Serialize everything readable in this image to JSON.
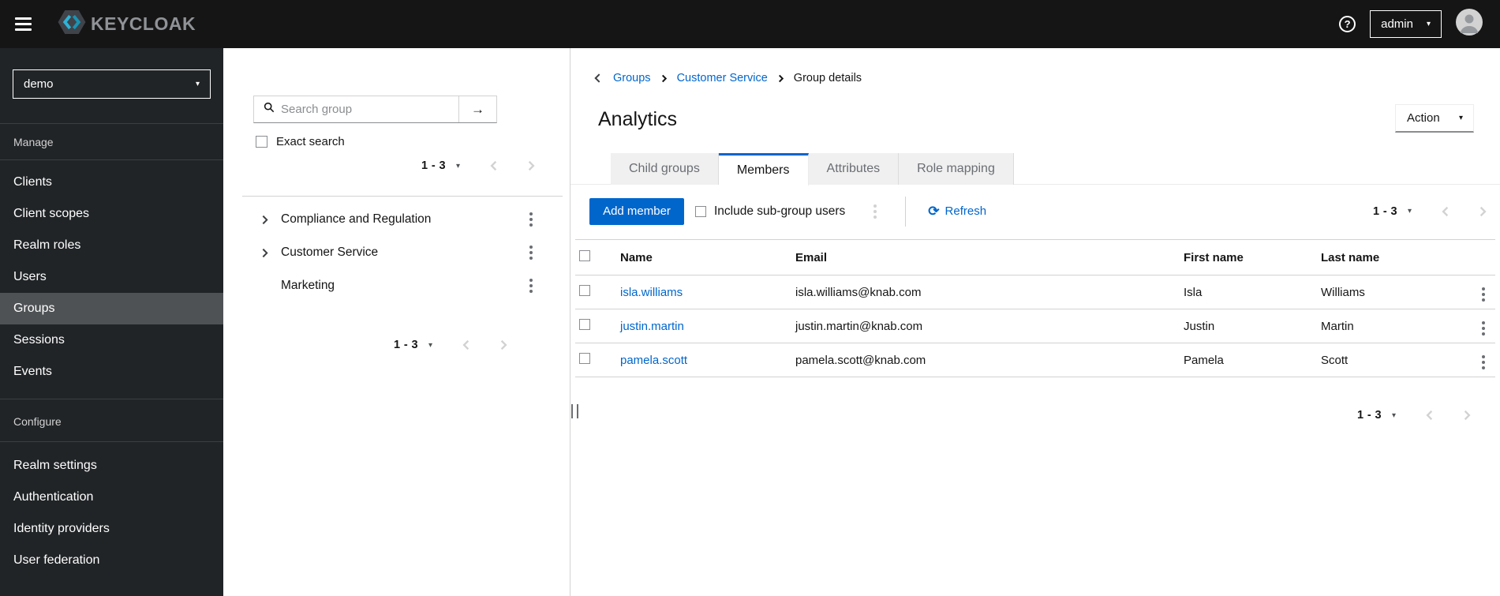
{
  "icons": {
    "caret_down": "▾",
    "arrow_right": "→",
    "refresh": "⟳",
    "help": "?"
  },
  "header": {
    "brand": "KEYCLOAK",
    "user": "admin"
  },
  "sidebar": {
    "realm": "demo",
    "selected_item": "Groups",
    "groups": [
      {
        "label": "Manage",
        "items": [
          "Clients",
          "Client scopes",
          "Realm roles",
          "Users",
          "Groups",
          "Sessions",
          "Events"
        ]
      },
      {
        "label": "Configure",
        "items": [
          "Realm settings",
          "Authentication",
          "Identity providers",
          "User federation"
        ]
      }
    ]
  },
  "group_panel": {
    "search_placeholder": "Search group",
    "exact_search_label": "Exact search",
    "pagination_top": {
      "range": "1 - 3"
    },
    "pagination_bottom": {
      "range": "1 - 3"
    },
    "items": [
      {
        "name": "Compliance and Regulation",
        "expandable": true
      },
      {
        "name": "Customer Service",
        "expandable": true
      },
      {
        "name": "Marketing",
        "expandable": false
      }
    ]
  },
  "main": {
    "breadcrumb": [
      "Groups",
      "Customer Service",
      "Group details"
    ],
    "title": "Analytics",
    "action_label": "Action",
    "tabs": [
      {
        "label": "Child groups"
      },
      {
        "label": "Members"
      },
      {
        "label": "Attributes"
      },
      {
        "label": "Role mapping"
      }
    ],
    "active_tab": "Members",
    "toolbar": {
      "add_member_label": "Add member",
      "include_subgroup_label": "Include sub-group users",
      "refresh_label": "Refresh"
    },
    "pagination_top": {
      "range": "1 - 3"
    },
    "pagination_bottom": {
      "range": "1 - 3"
    },
    "table": {
      "columns": [
        "Name",
        "Email",
        "First name",
        "Last name"
      ],
      "rows": [
        {
          "name": "isla.williams",
          "email": "isla.williams@knab.com",
          "first_name": "Isla",
          "last_name": "Williams"
        },
        {
          "name": "justin.martin",
          "email": "justin.martin@knab.com",
          "first_name": "Justin",
          "last_name": "Martin"
        },
        {
          "name": "pamela.scott",
          "email": "pamela.scott@knab.com",
          "first_name": "Pamela",
          "last_name": "Scott"
        }
      ]
    }
  },
  "colors": {
    "accent": "#0066cc",
    "link": "#0066cc",
    "header_bg": "#151515",
    "sidebar_bg": "#212427",
    "sidebar_selected": "#4f5255",
    "tab_inactive_bg": "#f0f0f0",
    "border": "#d2d2d2"
  }
}
